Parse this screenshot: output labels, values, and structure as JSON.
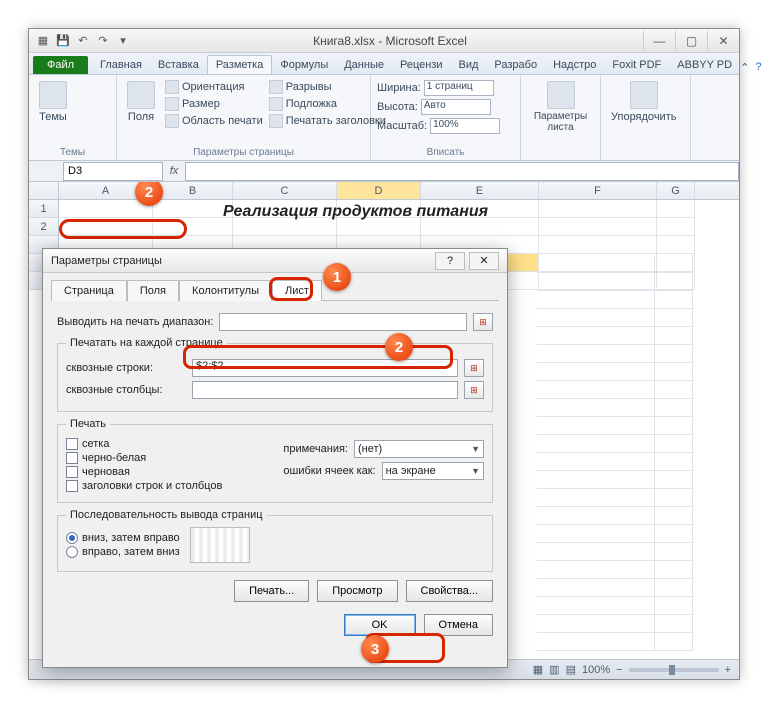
{
  "title": "Книга8.xlsx - Microsoft Excel",
  "qat": {
    "save": "save",
    "undo": "undo",
    "redo": "redo"
  },
  "tabs": {
    "file": "Файл",
    "items": [
      "Главная",
      "Вставка",
      "Разметка",
      "Формулы",
      "Данные",
      "Рецензи",
      "Вид",
      "Разрабо",
      "Надстро",
      "Foxit PDF",
      "ABBYY PD"
    ],
    "active_index": 2
  },
  "ribbon": {
    "group_themes": {
      "name": "Темы",
      "themes_btn": "Темы"
    },
    "group_page": {
      "name": "Параметры страницы",
      "margins": "Поля",
      "orientation": "Ориентация",
      "size": "Размер",
      "print_area": "Область печати",
      "breaks": "Разрывы",
      "background": "Подложка",
      "print_titles": "Печатать заголовки"
    },
    "group_fit": {
      "name": "Вписать",
      "width_lbl": "Ширина:",
      "width_val": "1 страниц",
      "height_lbl": "Высота:",
      "height_val": "Авто",
      "scale_lbl": "Масштаб:",
      "scale_val": "100%"
    },
    "group_sheetopts": {
      "name": "Параметры листа",
      "btn": "Параметры листа"
    },
    "group_arrange": {
      "name": "—",
      "btn": "Упорядочить"
    }
  },
  "namebox": "D3",
  "columns": [
    "A",
    "B",
    "C",
    "D",
    "E",
    "F",
    "G"
  ],
  "sheet_title": "Реализация продуктов питания",
  "dialog": {
    "title": "Параметры страницы",
    "tabs": [
      "Страница",
      "Поля",
      "Колонтитулы",
      "Лист"
    ],
    "active_tab": 3,
    "print_range_lbl": "Выводить на печать диапазон:",
    "print_range_val": "",
    "repeat_group": "Печатать на каждой странице",
    "rows_lbl": "сквозные строки:",
    "rows_val": "$2:$2",
    "cols_lbl": "сквозные столбцы:",
    "cols_val": "",
    "print_group": "Печать",
    "chk_grid": "сетка",
    "chk_bw": "черно-белая",
    "chk_draft": "черновая",
    "chk_headings": "заголовки строк и столбцов",
    "comments_lbl": "примечания:",
    "comments_val": "(нет)",
    "errors_lbl": "ошибки ячеек как:",
    "errors_val": "на экране",
    "order_group": "Последовательность вывода страниц",
    "order_down": "вниз, затем вправо",
    "order_over": "вправо, затем вниз",
    "btn_print": "Печать...",
    "btn_preview": "Просмотр",
    "btn_props": "Свойства...",
    "btn_ok": "OK",
    "btn_cancel": "Отмена"
  },
  "status": {
    "zoom": "100%"
  },
  "badges": {
    "b1": "1",
    "b2": "2",
    "b3": "3"
  }
}
